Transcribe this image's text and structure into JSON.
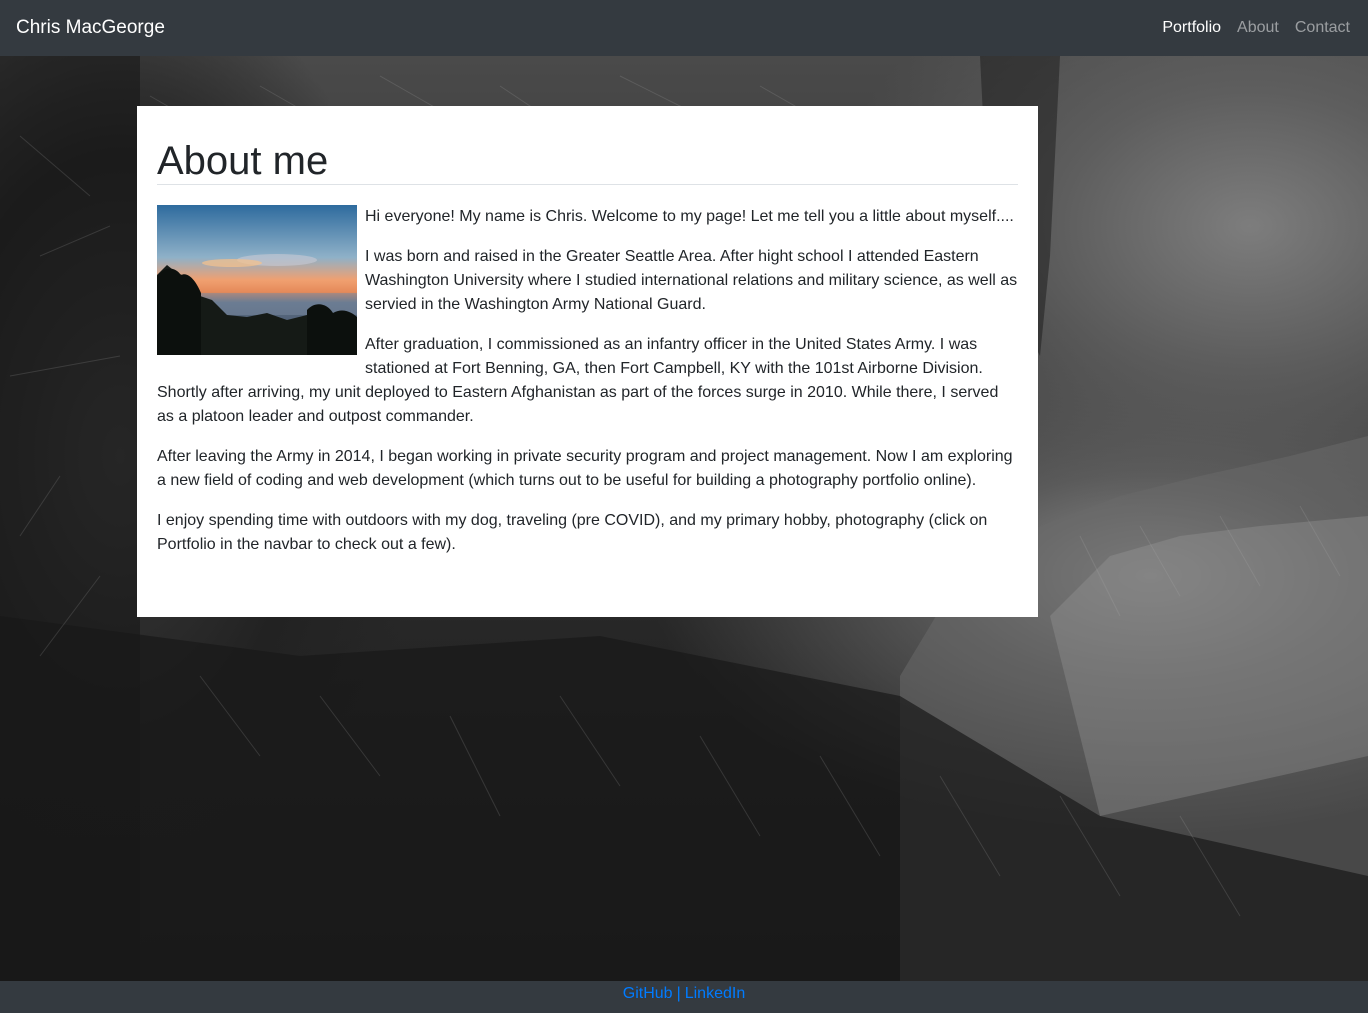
{
  "navbar": {
    "brand": "Chris MacGeorge",
    "links": [
      {
        "label": "Portfolio",
        "active": true
      },
      {
        "label": "About",
        "active": false
      },
      {
        "label": "Contact",
        "active": false
      }
    ]
  },
  "main": {
    "title": "About me",
    "paragraphs": [
      "Hi everyone! My name is Chris. Welcome to my page! Let me tell you a little about myself....",
      "I was born and raised in the Greater Seattle Area. After hight school I attended Eastern Washington University where I studied international relations and military science, as well as servied in the Washington Army National Guard.",
      "After graduation, I commissioned as an infantry officer in the United States Army. I was stationed at Fort Benning, GA, then Fort Campbell, KY with the 101st Airborne Division. Shortly after arriving, my unit deployed to Eastern Afghanistan as part of the forces surge in 2010. While there, I served as a platoon leader and outpost commander.",
      "After leaving the Army in 2014, I began working in private security program and project management. Now I am exploring a new field of coding and web development (which turns out to be useful for building a photography portfolio online).",
      "I enjoy spending time with outdoors with my dog, traveling (pre COVID), and my primary hobby, photography (click on Portfolio in the navbar to check out a few)."
    ]
  },
  "footer": {
    "github": "GitHub",
    "separator": "|",
    "linkedin": "LinkedIn"
  },
  "colors": {
    "navbar_bg": "#343a40",
    "link": "#007bff",
    "text": "#212529"
  }
}
